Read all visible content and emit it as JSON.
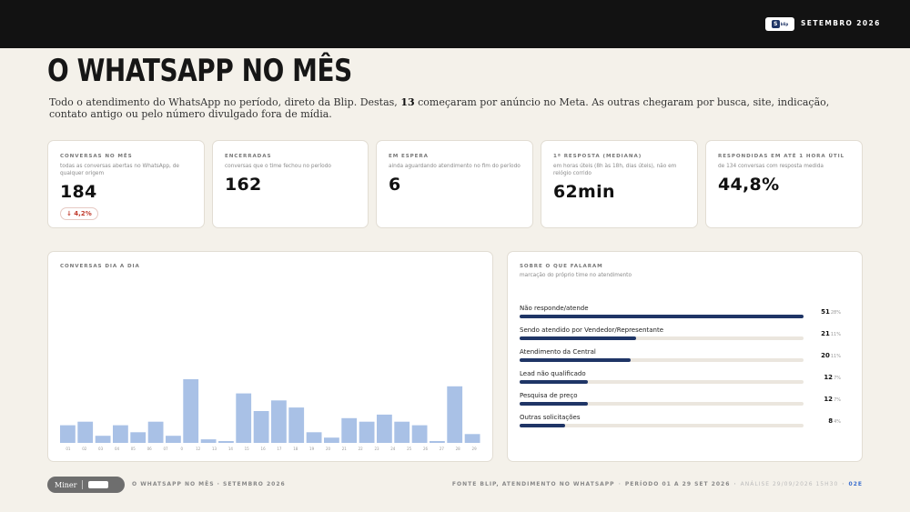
{
  "header": {
    "period": "SETEMBRO 2026",
    "brand_logo": "blip-logo"
  },
  "page": {
    "title": "O WHATSAPP NO MÊS",
    "intro_before": "Todo o atendimento do WhatsApp no período, direto da Blip. Destas, ",
    "intro_bold": "13",
    "intro_after": " começaram por anúncio no Meta. As outras chegaram por busca, site, indicação, contato antigo ou pelo número divulgado fora de mídia."
  },
  "kpis": [
    {
      "label": "CONVERSAS NO MÊS",
      "sub": "todas as conversas abertas no WhatsApp, de qualquer origem",
      "value": "184",
      "delta": "↓ 4,2%",
      "delta_color": "#c0392b"
    },
    {
      "label": "ENCERRADAS",
      "sub": "conversas que o time fechou no período",
      "value": "162"
    },
    {
      "label": "EM ESPERA",
      "sub": "ainda aguardando atendimento no fim do período",
      "value": "6"
    },
    {
      "label": "1ª RESPOSTA (MEDIANA)",
      "sub": "em horas úteis (8h às 18h, dias úteis), não em relógio corrido",
      "value": "62min"
    },
    {
      "label": "RESPONDIDAS EM ATÉ 1 HORA ÚTIL",
      "sub": "de 134 conversas com resposta medida",
      "value": "44,8%"
    }
  ],
  "daily_panel": {
    "label": "CONVERSAS DIA A DIA"
  },
  "chart_data": {
    "type": "bar",
    "categories": [
      "01",
      "02",
      "03",
      "04",
      "05",
      "06",
      "07",
      "08",
      "09",
      "10",
      "11",
      "12",
      "13",
      "14",
      "15",
      "16",
      "17",
      "18",
      "19",
      "20",
      "21",
      "22",
      "23",
      "24",
      "25",
      "26",
      "27",
      "28",
      "29"
    ],
    "x_tick_labels": [
      "01",
      "02",
      "03",
      "04",
      "05",
      "06",
      "07",
      "0",
      "12",
      "13",
      "14",
      "15",
      "16",
      "17",
      "18",
      "19",
      "20",
      "21",
      "22",
      "23",
      "24",
      "25",
      "26",
      "27",
      "28",
      "29"
    ],
    "values": [
      5,
      6,
      2,
      5,
      3,
      6,
      2,
      18,
      1,
      0.5,
      14,
      9,
      12,
      10,
      3,
      1.5,
      7,
      6,
      8,
      6,
      5,
      0.5,
      16,
      2.5
    ],
    "bar_color": "#a9c1e6",
    "grid": false
  },
  "topics_panel": {
    "label": "SOBRE O QUE FALARAM",
    "sub": "marcação do próprio time no atendimento",
    "bar_color": "#1f3566",
    "items": [
      {
        "name": "Não responde/atende",
        "count": "51",
        "pct": "28%",
        "share": 1.0
      },
      {
        "name": "Sendo atendido por Vendedor/Representante",
        "count": "21",
        "pct": "11%",
        "share": 0.41
      },
      {
        "name": "Atendimento da Central",
        "count": "20",
        "pct": "11%",
        "share": 0.39
      },
      {
        "name": "Lead não qualificado",
        "count": "12",
        "pct": "7%",
        "share": 0.24
      },
      {
        "name": "Pesquisa de preço",
        "count": "12",
        "pct": "7%",
        "share": 0.24
      },
      {
        "name": "Outras solicitações",
        "count": "8",
        "pct": "4%",
        "share": 0.16
      }
    ]
  },
  "footer": {
    "logo_text": "Miner",
    "left": "O WHATSAPP NO MÊS · SETEMBRO 2026",
    "source": "FONTE BLIP, ATENDIMENTO NO WHATSAPP",
    "period": "PERÍODO 01 A 29 SET 2026",
    "analysis": "ANÁLISE 29/09/2026 15H30",
    "page": "02E"
  }
}
